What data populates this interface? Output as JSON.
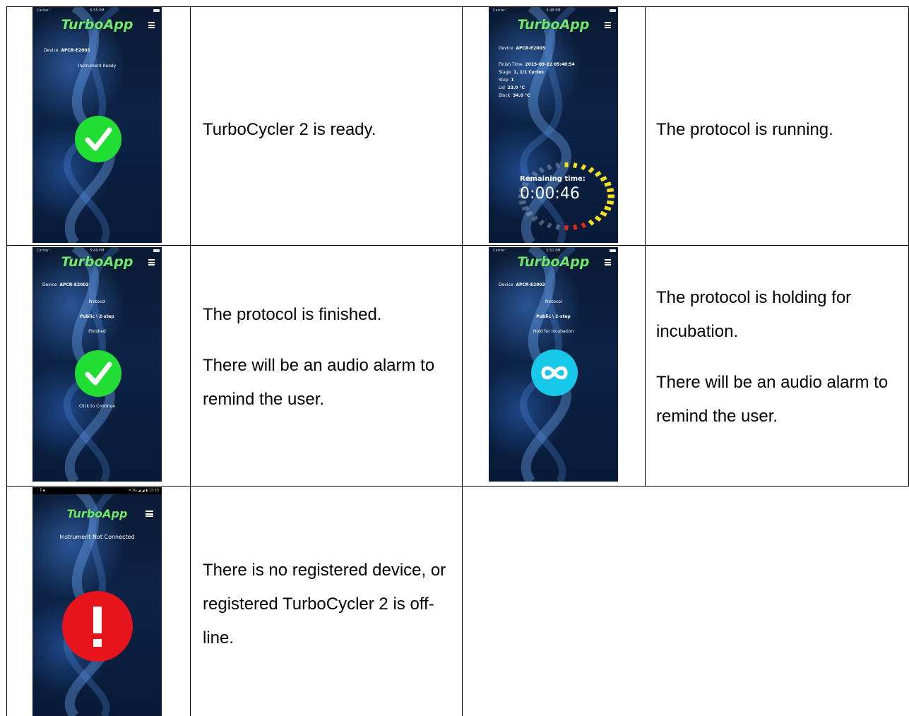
{
  "rows": [
    {
      "left": {
        "phone": {
          "status_carrier": "Carrier ⁚",
          "status_time": "5:55 PM",
          "app_title": "TurboApp",
          "device_label": "Device",
          "device_value": "APCR-E2003",
          "message": "Instrument Ready",
          "badge_icon": "checkmark-icon",
          "badge_color": "#22dd33"
        },
        "text": [
          "TurboCycler 2 is ready."
        ]
      },
      "right": {
        "phone": {
          "status_carrier": "Carrier ⁚",
          "status_time": "5:48 PM",
          "app_title": "TurboApp",
          "device_label": "Device",
          "device_value": "APCR-E2003",
          "details": [
            {
              "label": "Finish Time",
              "value": "2015-09-22 05:48:54"
            },
            {
              "label": "Stage",
              "value": "1, 1/1 Cycles"
            },
            {
              "label": "Step",
              "value": "1"
            },
            {
              "label": "Lid",
              "value": "23.0 °C"
            },
            {
              "label": "Block",
              "value": "34.0 °C"
            }
          ],
          "remaining_label": "Remaining time:",
          "remaining_value": "0:00:46",
          "gauge_color_active": "#f4e020",
          "gauge_color_end": "#e02818"
        },
        "text": [
          "The protocol is running."
        ]
      }
    },
    {
      "left": {
        "phone": {
          "status_carrier": "Carrier ⁚",
          "status_time": "5:49 PM",
          "app_title": "TurboApp",
          "device_label": "Device",
          "device_value": "APCR-E2003",
          "lines": [
            "Protocol",
            "Public \\ 2-step",
            "Finished"
          ],
          "footer": "Click to Continue",
          "badge_icon": "checkmark-icon",
          "badge_color": "#22dd33"
        },
        "text": [
          "The protocol is finished.",
          "There will be an audio alarm to remind the user."
        ]
      },
      "right": {
        "phone": {
          "status_carrier": "Carrier ⁚",
          "status_time": "5:51 PM",
          "app_title": "TurboApp",
          "device_label": "Device",
          "device_value": "APCR-E2003",
          "lines": [
            "Protocol",
            "Public \\ 2-step",
            "Hold for incubation"
          ],
          "badge_icon": "infinity-icon",
          "badge_color": "#18c8e8"
        },
        "text": [
          "The protocol is holding for incubation.",
          "There will be an audio alarm to remind the user."
        ]
      }
    },
    {
      "left": {
        "phone": {
          "status_carrier": "◦ ⁑ ▪",
          "status_time": "⌗ 3G ◢ ◢ ▮ 13:23",
          "app_title": "TurboApp",
          "message": "Instrument Not Connected",
          "badge_icon": "exclamation-icon",
          "badge_color": "#e8141c"
        },
        "text": [
          "There is no registered device, or registered TurboCycler 2 is off-line."
        ]
      }
    }
  ]
}
